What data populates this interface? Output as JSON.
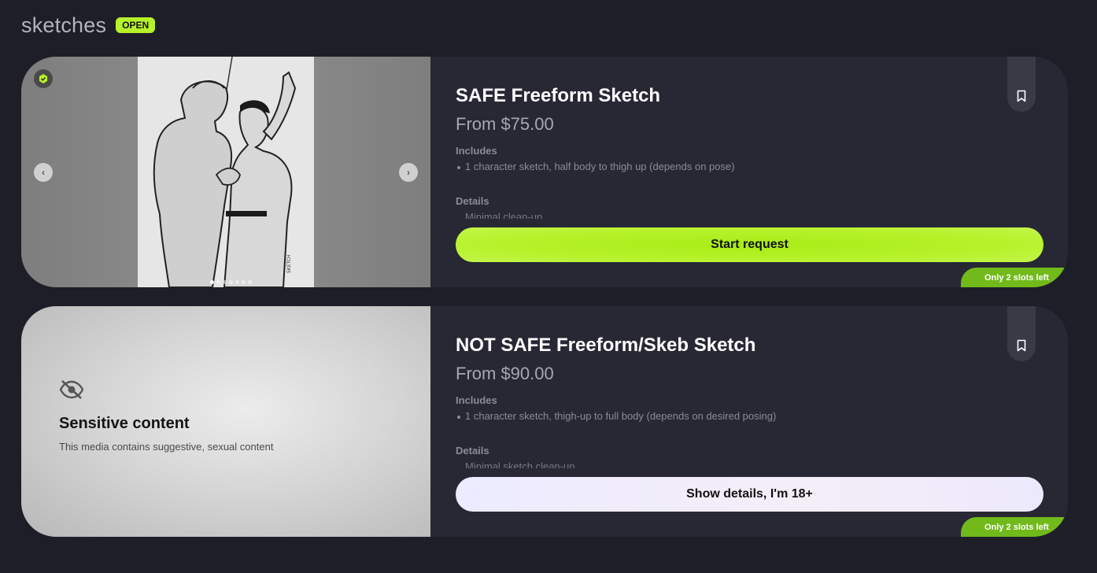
{
  "section": {
    "title": "sketches",
    "status_badge": "OPEN"
  },
  "cards": [
    {
      "title": "SAFE Freeform Sketch",
      "price": "From $75.00",
      "includes_label": "Includes",
      "includes": [
        "1 character sketch, half body to thigh up (depends on pose)"
      ],
      "details_label": "Details",
      "details": [
        "Minimal clean-up"
      ],
      "cta_label": "Start request",
      "slots_label": "Only 2 slots left",
      "media": {
        "safe_icon": "shield-check-icon",
        "prev_icon": "chevron-left-icon",
        "next_icon": "chevron-right-icon",
        "image_count": 7,
        "active_index": 0,
        "signature_text": "SKETCH"
      },
      "icons": {
        "bookmark": "bookmark-icon"
      }
    },
    {
      "title": "NOT SAFE Freeform/Skeb Sketch",
      "price": "From $90.00",
      "includes_label": "Includes",
      "includes": [
        "1 character sketch, thigh-up to full body (depends on desired posing)"
      ],
      "details_label": "Details",
      "details": [
        "Minimal sketch clean-up"
      ],
      "cta_label": "Show details, I'm 18+",
      "slots_label": "Only 2 slots left",
      "sensitive": {
        "icon": "eye-slash-icon",
        "title": "Sensitive content",
        "description": "This media contains suggestive, sexual content"
      },
      "icons": {
        "bookmark": "bookmark-icon"
      }
    }
  ],
  "colors": {
    "background": "#1e1e28",
    "card": "#282835",
    "accent_green": "#b6f22a",
    "slots_green": "#72ba1b",
    "muted_text": "#8b8b98"
  }
}
